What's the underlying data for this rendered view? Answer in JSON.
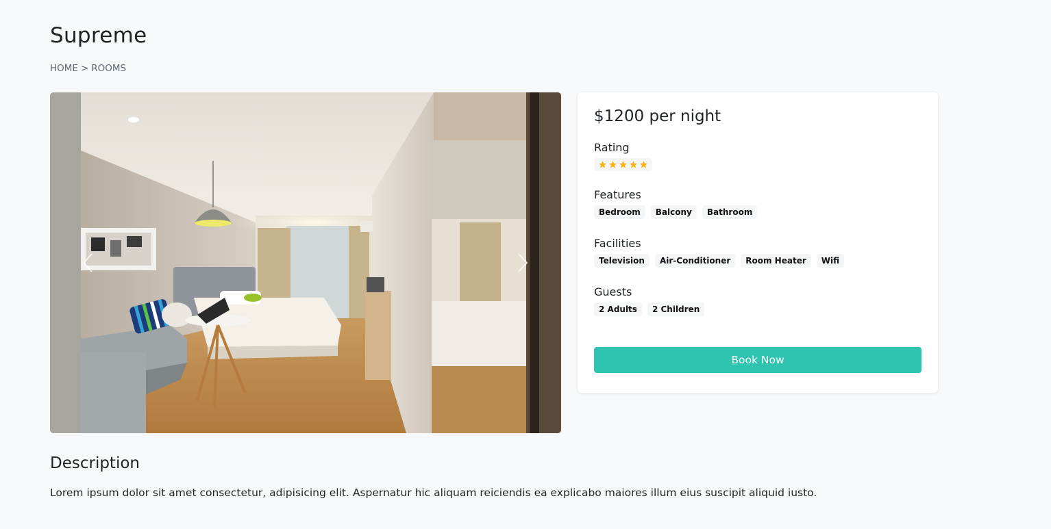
{
  "page": {
    "title": "Supreme",
    "breadcrumb": {
      "home": "HOME",
      "separator": ">",
      "current": "ROOMS"
    }
  },
  "gallery": {
    "prev_icon": "chevron-left-icon",
    "next_icon": "chevron-right-icon"
  },
  "booking": {
    "price": "$1200 per night",
    "rating_label": "Rating",
    "rating_stars": 5,
    "rating_max": 5,
    "features_label": "Features",
    "features": [
      "Bedroom",
      "Balcony",
      "Bathroom"
    ],
    "facilities_label": "Facilities",
    "facilities": [
      "Television",
      "Air-Conditioner",
      "Room Heater",
      "Wifi"
    ],
    "guests_label": "Guests",
    "guests": [
      "2 Adults",
      "2 Children"
    ],
    "book_label": "Book Now"
  },
  "description": {
    "title": "Description",
    "text": "Lorem ipsum dolor sit amet consectetur, adipisicing elit. Aspernatur hic aliquam reiciendis ea explicabo maiores illum eius suscipit aliquid iusto."
  },
  "colors": {
    "accent": "#2ec4b0",
    "star": "#f5b50a",
    "background": "#f7f8fa"
  }
}
